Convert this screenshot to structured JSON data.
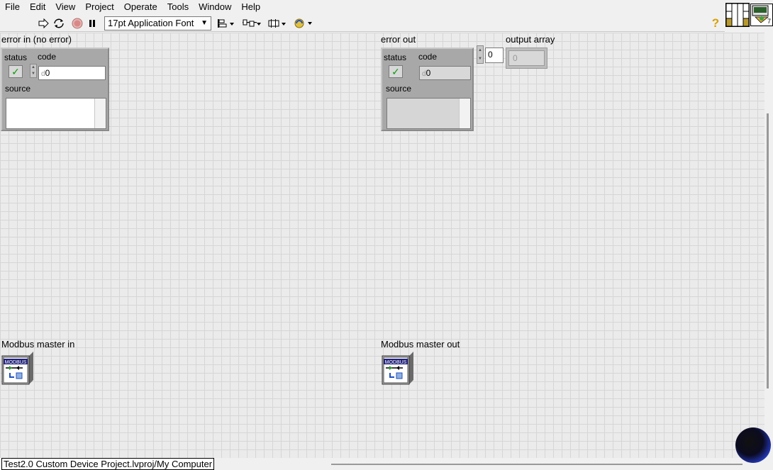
{
  "menu": [
    "File",
    "Edit",
    "View",
    "Project",
    "Operate",
    "Tools",
    "Window",
    "Help"
  ],
  "toolbar": {
    "font_select": "17pt Application Font",
    "icons": [
      "run-arrow-icon",
      "run-continuously-icon",
      "abort-icon",
      "pause-icon",
      "align-objects-icon",
      "distribute-objects-icon",
      "resize-objects-icon",
      "reorder-icon"
    ],
    "help_icon": "context-help-icon"
  },
  "controls": {
    "error_in": {
      "label": "error in (no error)",
      "status_label": "status",
      "code_label": "code",
      "code_value": "0",
      "source_label": "source",
      "radix": "d"
    },
    "error_out": {
      "label": "error out",
      "status_label": "status",
      "code_label": "code",
      "code_value": "0",
      "source_label": "source",
      "radix": "d"
    },
    "output_array": {
      "label": "output array",
      "index_value": "0",
      "element_value": "0"
    },
    "modbus_in": {
      "label": "Modbus master in",
      "icon_text": "MODBUS"
    },
    "modbus_out": {
      "label": "Modbus master out",
      "icon_text": "MODBUS"
    }
  },
  "statusbar": {
    "project_path": "Test2.0 Custom Device Project.lvproj/My Computer"
  },
  "vi_icon": {
    "digit": "7"
  }
}
